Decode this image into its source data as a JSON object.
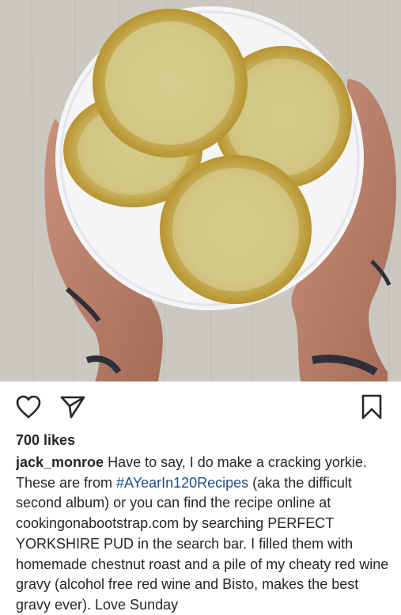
{
  "post": {
    "likes": "700 likes",
    "username": "jack_monroe",
    "caption_part1": " Have to say, I do make a cracking yorkie. These are from ",
    "hashtag": "#AYearIn120Recipes",
    "caption_part2": " (aka the difficult second album) or you can find the recipe online at cookingonabootstrap.com by searching PERFECT YORKSHIRE PUD in the search bar. I filled them with homemade chestnut roast and a pile of my cheaty red wine gravy (alcohol free red wine and Bisto, makes the best gravy ever). Love Sunday"
  },
  "icons": {
    "like": "heart-outline-icon",
    "share": "paper-plane-icon",
    "save": "bookmark-outline-icon"
  },
  "colors": {
    "text": "#262626",
    "hashtag": "#1a4f8b",
    "background": "#ffffff"
  }
}
